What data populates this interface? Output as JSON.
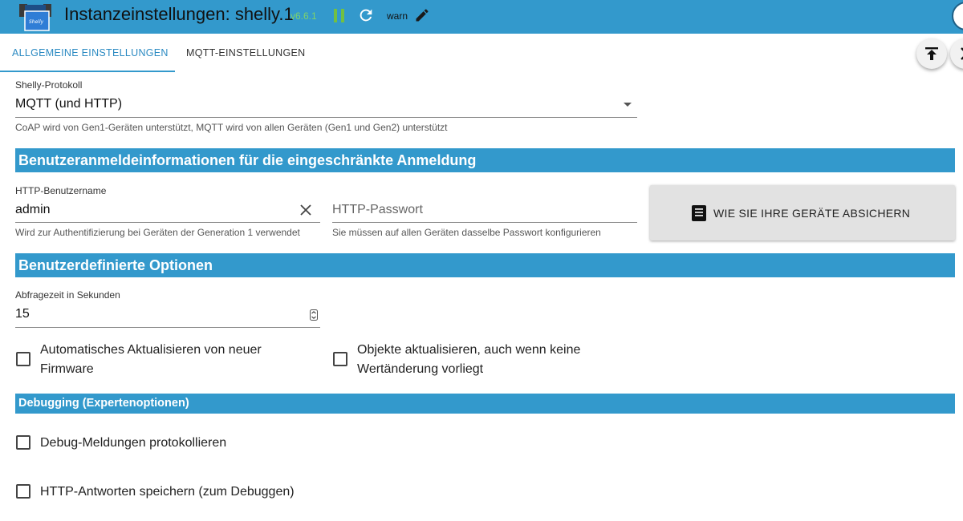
{
  "header": {
    "title": "Instanzeinstellungen: shelly.1",
    "version": "v6.6.1",
    "log_level": "warn",
    "icons": [
      "shelly-logo",
      "pause-icon",
      "reload-icon",
      "edit-icon"
    ],
    "colors": {
      "bar": "#3399cc",
      "version": "#7ed36a",
      "pause": "#72c041"
    }
  },
  "tabs": [
    {
      "label": "ALLGEMEINE EINSTELLUNGEN",
      "active": true
    },
    {
      "label": "MQTT-EINSTELLUNGEN",
      "active": false
    }
  ],
  "protocol": {
    "label": "Shelly-Protokoll",
    "value": "MQTT (und HTTP)",
    "helper": "CoAP wird von Gen1-Geräten unterstützt, MQTT wird von allen Geräten (Gen1 und Gen2) unterstützt"
  },
  "section_credentials": "Benutzeranmeldeinformationen für die eingeschränkte Anmeldung",
  "username": {
    "label": "HTTP-Benutzername",
    "value": "admin",
    "helper": "Wird zur Authentifizierung bei Geräten der Generation 1 verwendet"
  },
  "password": {
    "placeholder": "HTTP-Passwort",
    "helper": "Sie müssen auf allen Geräten dasselbe Passwort konfigurieren"
  },
  "secure_button": {
    "label": "WIE SIE IHRE GERÄTE ABSICHERN",
    "icon": "book-icon"
  },
  "section_custom": "Benutzerdefinierte Optionen",
  "polling": {
    "label": "Abfragezeit in Sekunden",
    "value": "15"
  },
  "checkboxes": {
    "auto_update_line1": "Automatisches Aktualisieren von neuer",
    "auto_update_line2": "Firmware",
    "update_objects_line1": "Objekte aktualisieren, auch wenn keine",
    "update_objects_line2": "Wertänderung vorliegt",
    "debug_log": "Debug-Meldungen protokollieren",
    "save_http": "HTTP-Antworten speichern (zum Debuggen)"
  },
  "section_debug": "Debugging (Expertenoptionen)"
}
